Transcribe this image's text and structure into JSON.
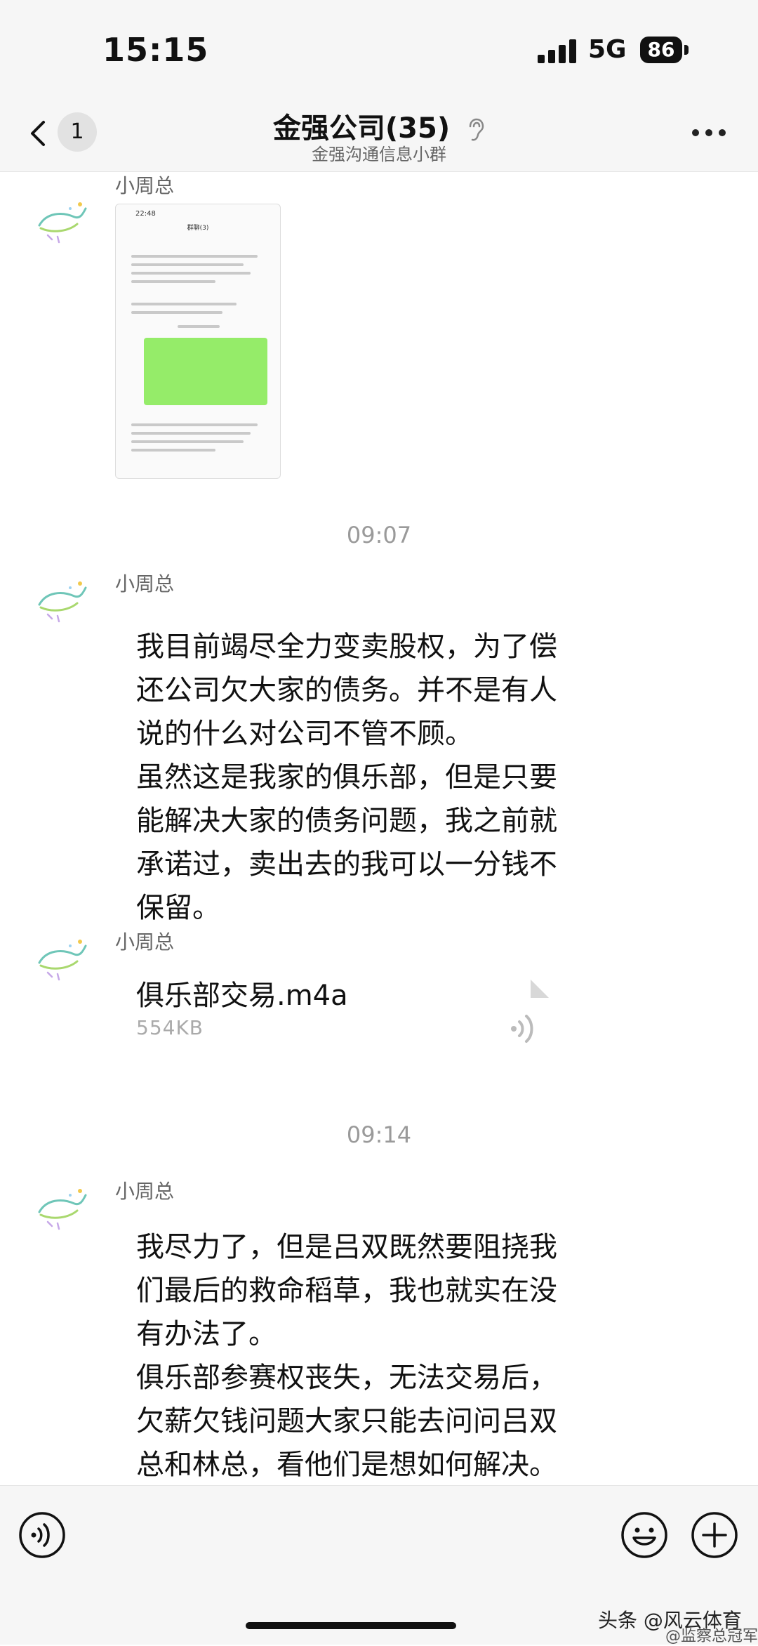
{
  "status": {
    "time": "15:15",
    "network": "5G",
    "battery": "86"
  },
  "header": {
    "back_count": "1",
    "title": "金强公司(35)",
    "subtitle": "金强沟通信息小群",
    "ear_icon": "ear-icon",
    "more_icon": "more-icon"
  },
  "messages": [
    {
      "sender": "小周总",
      "type": "image",
      "shot_time": "22:48",
      "shot_header": "群聊(3)"
    },
    {
      "time_separator": "09:07"
    },
    {
      "sender": "小周总",
      "type": "text",
      "text": "我目前竭尽全力变卖股权，为了偿\n还公司欠大家的债务。并不是有人\n说的什么对公司不管不顾。\n虽然这是我家的俱乐部，但是只要\n能解决大家的债务问题，我之前就\n承诺过，卖出去的我可以一分钱不\n保留。"
    },
    {
      "sender": "小周总",
      "type": "file",
      "file_name": "俱乐部交易.m4a",
      "file_size": "554KB"
    },
    {
      "time_separator": "09:14"
    },
    {
      "sender": "小周总",
      "type": "text",
      "text": "我尽力了，但是吕双既然要阻挠我\n们最后的救命稻草，我也就实在没\n有办法了。\n俱乐部参赛权丧失，无法交易后，\n欠薪欠钱问题大家只能去问问吕双\n总和林总，看他们是想如何解决。"
    }
  ],
  "watermark": {
    "main": "头条 @风云体育",
    "sub": "@监察总冠军"
  }
}
